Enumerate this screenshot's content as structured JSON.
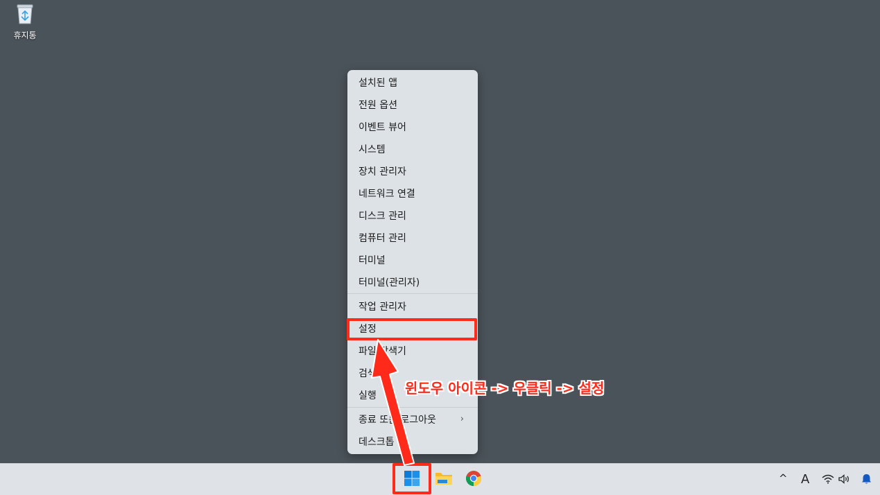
{
  "desktop": {
    "recycle_bin_label": "휴지통",
    "recycle_bin_icon": "recycle-bin-icon"
  },
  "context_menu": {
    "items": [
      {
        "label": "설치된 앱"
      },
      {
        "label": "전원 옵션"
      },
      {
        "label": "이벤트 뷰어"
      },
      {
        "label": "시스템"
      },
      {
        "label": "장치 관리자"
      },
      {
        "label": "네트워크 연결"
      },
      {
        "label": "디스크 관리"
      },
      {
        "label": "컴퓨터 관리"
      },
      {
        "label": "터미널"
      },
      {
        "label": "터미널(관리자)"
      },
      {
        "label": "작업 관리자"
      },
      {
        "label": "설정"
      },
      {
        "label": "파일 탐색기"
      },
      {
        "label": "검색"
      },
      {
        "label": "실행"
      },
      {
        "label": "종료 또는 로그아웃",
        "submenu": true
      },
      {
        "label": "데스크톱"
      }
    ],
    "submenu_chevron": "›"
  },
  "annotation": {
    "text": "윈도우 아이콘 -> 우클릭 -> 설정",
    "color": "#ff2a1a"
  },
  "taskbar": {
    "apps": [
      "start-icon",
      "file-explorer-icon",
      "chrome-icon"
    ],
    "tray": {
      "chevron": "^",
      "ime": "A",
      "wifi_icon": "wifi-icon",
      "volume_icon": "volume-icon",
      "notification_icon": "bell-icon"
    }
  },
  "colors": {
    "desktop_bg": "#4b535a",
    "menu_bg": "#dde2e6",
    "taskbar_bg": "#dfe3e8",
    "accent": "#0078d4",
    "annotation": "#ff2a1a"
  }
}
